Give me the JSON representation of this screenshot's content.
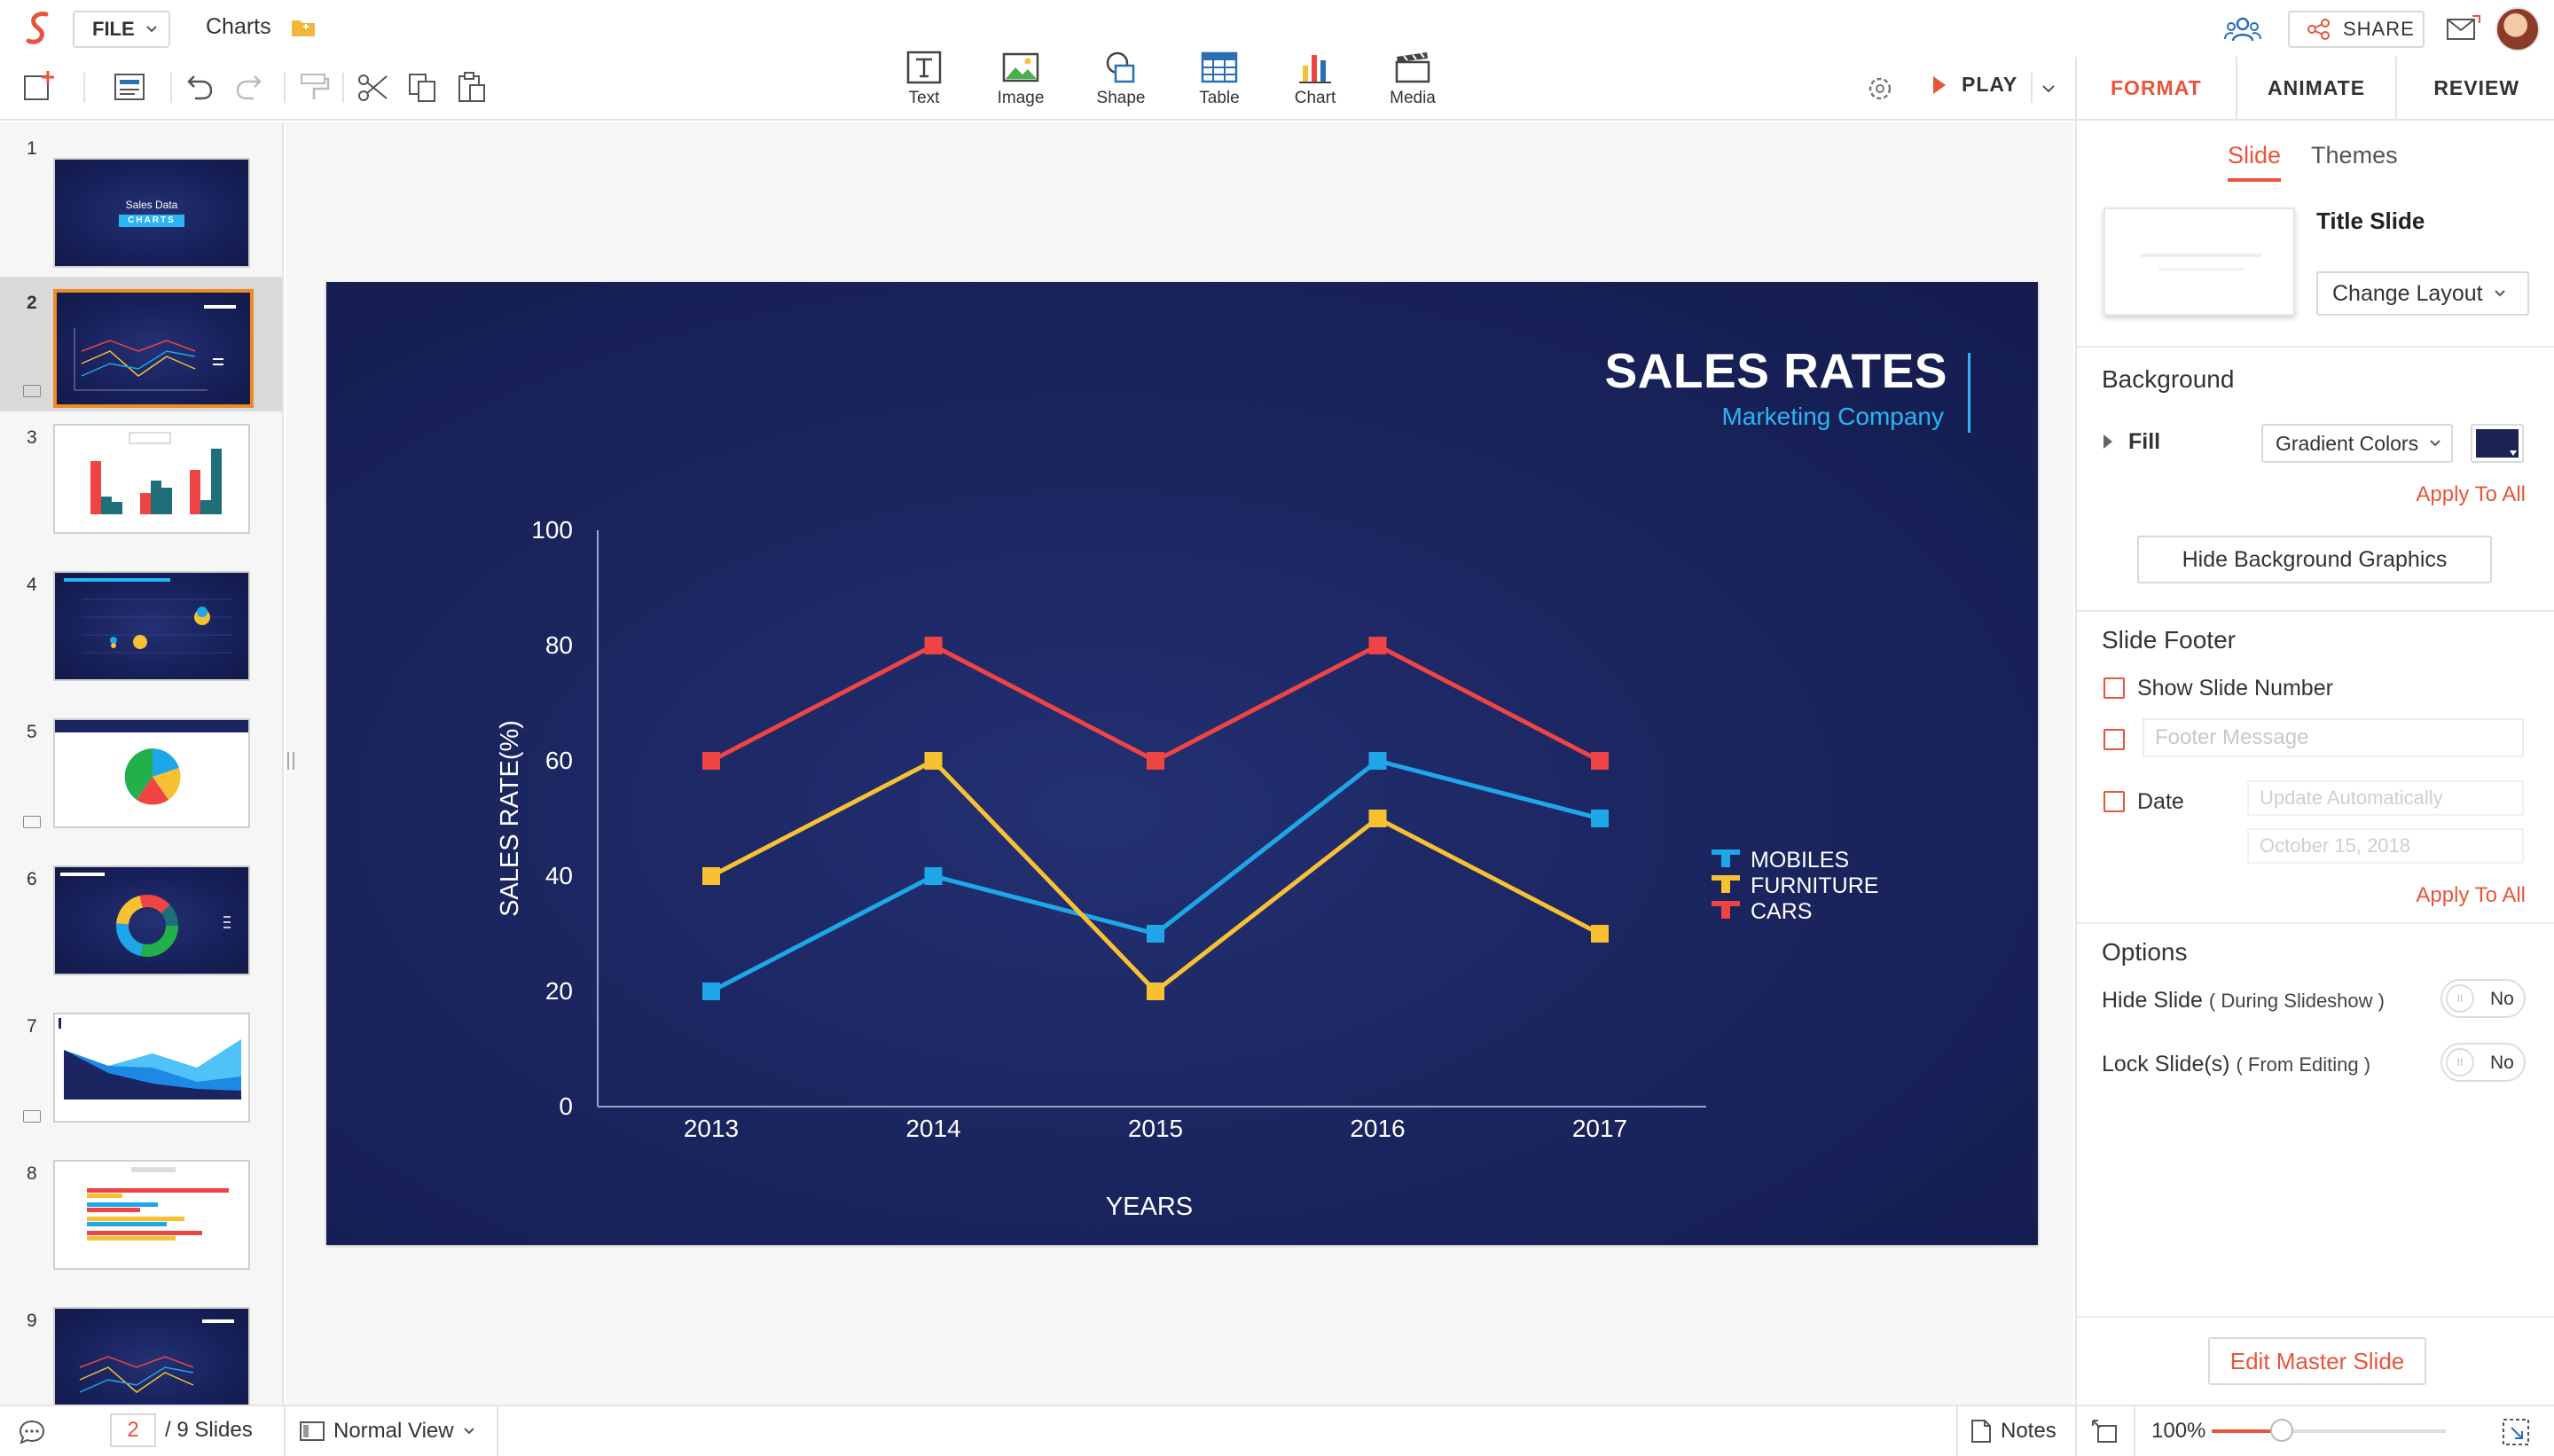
{
  "app": {
    "file_label": "FILE",
    "doc_title": "Charts"
  },
  "header": {
    "share_label": "SHARE"
  },
  "insert": {
    "text": "Text",
    "image": "Image",
    "shape": "Shape",
    "table": "Table",
    "chart": "Chart",
    "media": "Media"
  },
  "play": {
    "label": "PLAY"
  },
  "right_panel": {
    "tabs": [
      "FORMAT",
      "ANIMATE",
      "REVIEW"
    ],
    "subtabs": [
      "Slide",
      "Themes"
    ],
    "layout_name": "Title Slide",
    "change_layout": "Change Layout",
    "background": {
      "heading": "Background",
      "fill_label": "Fill",
      "fill_value": "Gradient Colors",
      "fill_color": "#1a2354",
      "apply_all": "Apply To All",
      "hide_graphics": "Hide Background Graphics"
    },
    "footer": {
      "heading": "Slide Footer",
      "show_number": "Show Slide Number",
      "footer_placeholder": "Footer Message",
      "date_label": "Date",
      "date_mode": "Update Automatically",
      "date_value": "October 15, 2018",
      "apply_all": "Apply To All"
    },
    "options": {
      "heading": "Options",
      "hide_slide": "Hide Slide",
      "hide_slide_note": "( During Slideshow )",
      "lock_slide": "Lock Slide(s)",
      "lock_slide_note": "( From Editing )",
      "toggle_value": "No"
    },
    "edit_master": "Edit Master Slide"
  },
  "slides_panel": {
    "numbers": [
      "1",
      "2",
      "3",
      "4",
      "5",
      "6",
      "7",
      "8",
      "9"
    ],
    "thumb1_title": "Sales Data",
    "thumb1_subtitle": "CHARTS"
  },
  "slide": {
    "title": "SALES RATES",
    "subtitle": "Marketing Company"
  },
  "chart_data": {
    "type": "line",
    "x": [
      "2013",
      "2014",
      "2015",
      "2016",
      "2017"
    ],
    "series": [
      {
        "name": "MOBILES",
        "values": [
          20,
          40,
          30,
          60,
          50
        ],
        "color": "#1ea7e8"
      },
      {
        "name": "FURNITURE",
        "values": [
          40,
          60,
          20,
          50,
          30
        ],
        "color": "#f8c132"
      },
      {
        "name": "CARS",
        "values": [
          60,
          80,
          60,
          80,
          60
        ],
        "color": "#ef4444"
      }
    ],
    "xlabel": "YEARS",
    "ylabel": "SALES RATE(%)",
    "ylim": [
      0,
      100
    ],
    "yticks": [
      "0",
      "20",
      "40",
      "60",
      "80",
      "100"
    ],
    "legend": "right"
  },
  "statusbar": {
    "current_page": "2",
    "total": "/ 9 Slides",
    "view": "Normal View",
    "notes": "Notes",
    "zoom": "100%",
    "zoom_fraction": 0.3
  }
}
